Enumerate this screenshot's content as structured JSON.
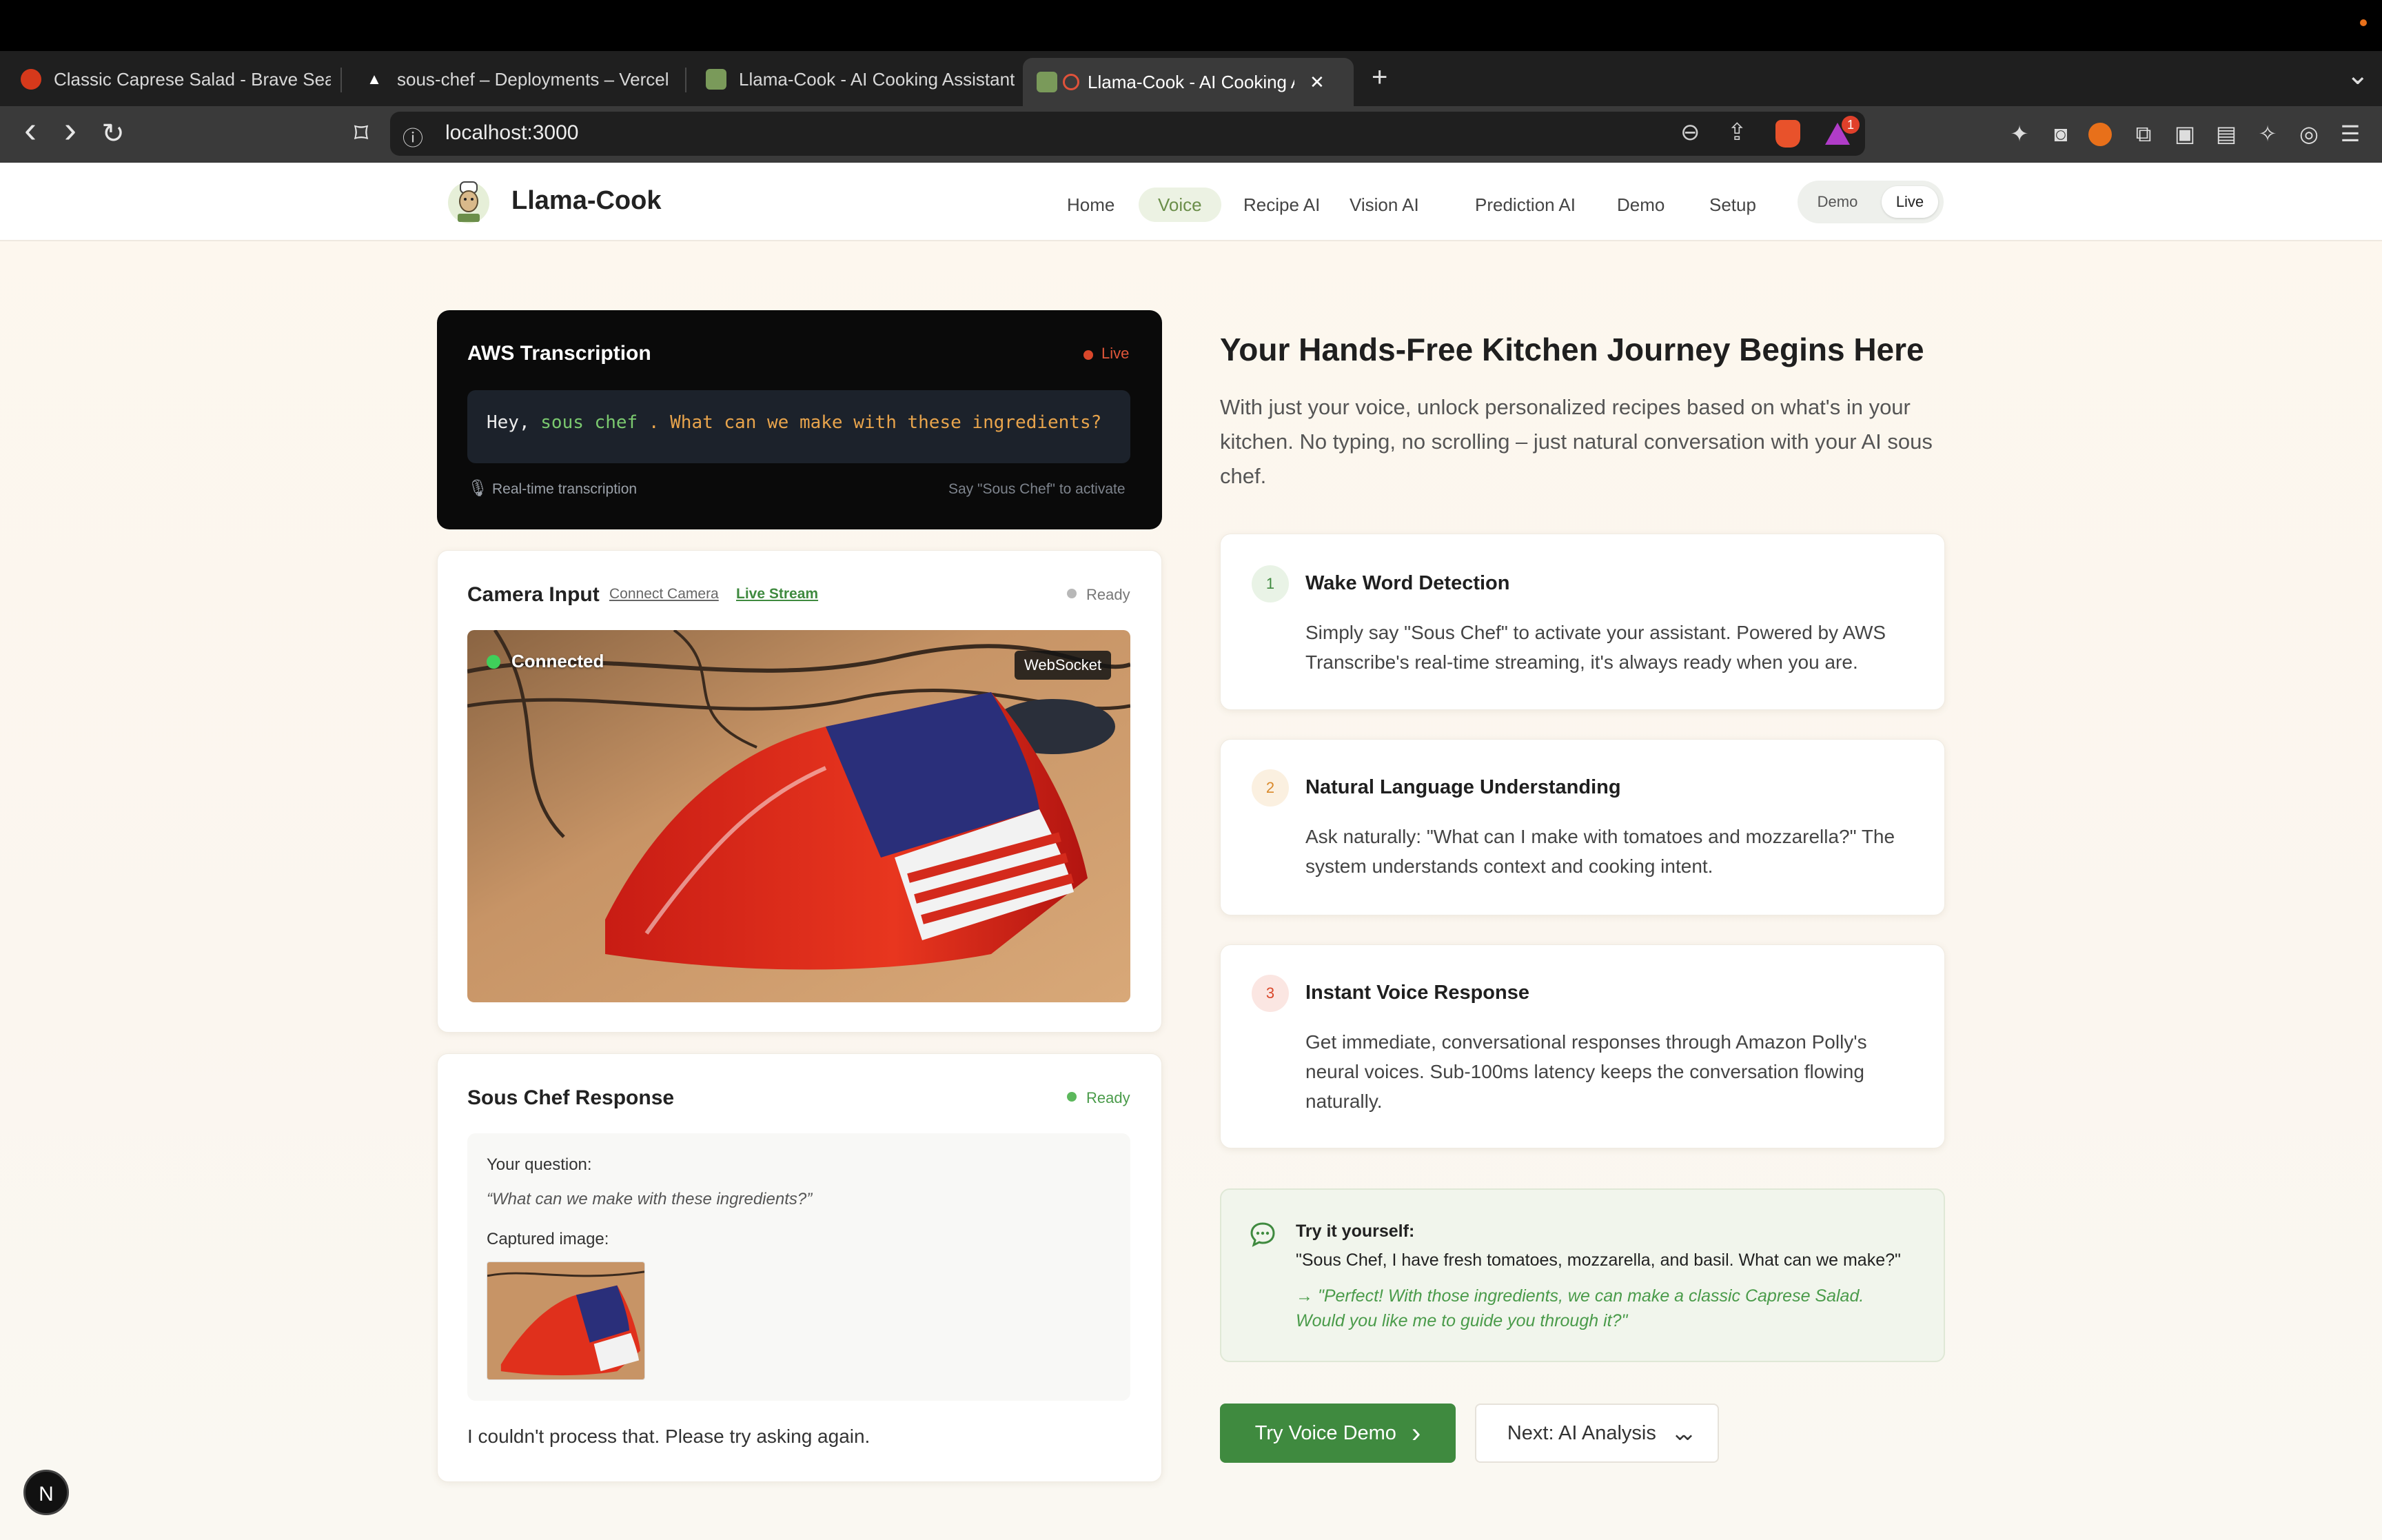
{
  "browser": {
    "tabs": [
      {
        "label": "Classic Caprese Salad - Brave Sea",
        "icon": "brave-search-icon",
        "active": false
      },
      {
        "label": "sous-chef – Deployments – Vercel",
        "icon": "vercel-icon",
        "active": false
      },
      {
        "label": "Llama-Cook - AI Cooking Assistant",
        "icon": "llama-cook-icon",
        "active": false
      },
      {
        "label": "Llama-Cook - AI Cooking A",
        "icon": "llama-cook-icon",
        "active": true
      }
    ],
    "close_glyph": "✕",
    "new_tab_glyph": "+",
    "tab_list_glyph": "⌄",
    "back_glyph": "‹",
    "forward_glyph": "›",
    "reload_glyph": "↻",
    "bookmark_glyph": "⌑",
    "info_glyph": "ⓘ",
    "url": "localhost:3000",
    "zoom_glyph": "⊖",
    "share_glyph": "⇪",
    "notification_count": "1",
    "menu_glyph": "☰"
  },
  "nav": {
    "brand": "Llama-Cook",
    "items": [
      {
        "label": "Home",
        "active": false
      },
      {
        "label": "Voice",
        "active": true
      },
      {
        "label": "Recipe AI",
        "active": false
      },
      {
        "label": "Vision AI",
        "active": false
      },
      {
        "label": "Prediction AI",
        "active": false
      },
      {
        "label": "Demo",
        "active": false
      },
      {
        "label": "Setup",
        "active": false
      }
    ],
    "mode": {
      "demo": "Demo",
      "live": "Live",
      "selected": "Live"
    }
  },
  "aws": {
    "title": "AWS Transcription",
    "status": "Live",
    "transcript": {
      "prefix": "Hey, ",
      "wake_word": "sous chef",
      "rest": " . What can we make with these ingredients?"
    },
    "mic_glyph": "🎙",
    "caption": "Real-time transcription",
    "hint": "Say \"Sous Chef\" to activate"
  },
  "camera": {
    "title": "Camera Input",
    "connect_link": "Connect Camera",
    "stream_link": "Live Stream",
    "status": "Ready",
    "connection": "Connected",
    "badge": "WebSocket"
  },
  "response": {
    "title": "Sous Chef Response",
    "status": "Ready",
    "question_label": "Your question:",
    "question": "“What can we make with these ingredients?”",
    "image_label": "Captured image:",
    "answer": "I couldn't process that. Please try asking again."
  },
  "hero": {
    "title": "Your Hands-Free Kitchen Journey Begins Here",
    "subtitle": "With just your voice, unlock personalized recipes based on what's in your kitchen. No typing, no scrolling – just natural conversation with your AI sous chef."
  },
  "features": [
    {
      "num": "1",
      "title": "Wake Word Detection",
      "desc": "Simply say \"Sous Chef\" to activate your assistant. Powered by AWS Transcribe's real-time streaming, it's always ready when you are.",
      "color": "#3f8a3f",
      "bg": "#e9f3e6"
    },
    {
      "num": "2",
      "title": "Natural Language Understanding",
      "desc": "Ask naturally: \"What can I make with tomatoes and mozzarella?\" The system understands context and cooking intent.",
      "color": "#d9892b",
      "bg": "#fbf0e0"
    },
    {
      "num": "3",
      "title": "Instant Voice Response",
      "desc": "Get immediate, conversational responses through Amazon Polly's neural voices. Sub-100ms latency keeps the conversation flowing naturally.",
      "color": "#d9472b",
      "bg": "#fbe6e2"
    }
  ],
  "try_it": {
    "label": "Try it yourself:",
    "quote": "\"Sous Chef, I have fresh tomatoes, mozzarella, and basil. What can we make?\"",
    "answer": "→ \"Perfect! With those ingredients, we can make a classic Caprese Salad. Would you like me to guide you through it?\""
  },
  "buttons": {
    "demo": "Try Voice Demo",
    "demo_glyph": "›",
    "next": "Next: AI Analysis",
    "next_glyph": "⌄⌄"
  },
  "dev_badge": "N",
  "colors": {
    "accent": "#3f8a3f",
    "live": "#d9472b",
    "wake": "#7bc96f",
    "query": "#e8a44c"
  }
}
